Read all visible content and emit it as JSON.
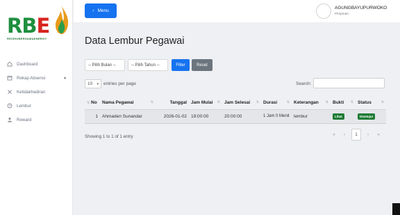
{
  "brand": {
    "logo_text_r": "R",
    "logo_text_b": "B",
    "logo_text_e": "E",
    "tagline": "REZEKIBERSAMAENERGY"
  },
  "sidebar": {
    "items": [
      {
        "label": "Dashboard",
        "icon": "home-icon"
      },
      {
        "label": "Rekap Absensi",
        "icon": "calendar-icon"
      },
      {
        "label": "Ketidakhadiran",
        "icon": "x-icon"
      },
      {
        "label": "Lembur",
        "icon": "clock-icon"
      },
      {
        "label": "Reward",
        "icon": "user-award-icon"
      }
    ]
  },
  "topbar": {
    "menu_label": "Menu",
    "user_name": "AGUNGBAYUPURWOKO",
    "user_role": "Pimpinan"
  },
  "page": {
    "title": "Data Lembur Pegawai"
  },
  "filters": {
    "month_select": "-- Pilih Bulan --",
    "year_select": "-- Pilih Tahun --",
    "filter_label": "Filter",
    "reset_label": "Reset"
  },
  "table_controls": {
    "length_value": "10",
    "length_suffix": "entries per page",
    "search_label": "Search:"
  },
  "table": {
    "headers": [
      "No",
      "Nama Pegawai",
      "Tanggal",
      "Jam Mulai",
      "Jam Selesai",
      "Durasi",
      "Keterangan",
      "Bukti",
      "Status"
    ],
    "rows": [
      {
        "no": "1",
        "nama": "Ahmaden Sunandar",
        "tanggal": "2026-01-02",
        "jam_mulai": "19:00:00",
        "jam_selesai": "20:00:00",
        "durasi": "1 Jam 0 Menit",
        "keterangan": "lembur",
        "bukti": "Lihat",
        "status": "Disetujui"
      }
    ]
  },
  "pagination": {
    "info": "Showing 1 to 1 of 1 entry",
    "first": "«",
    "prev": "‹",
    "current": "1",
    "next": "›",
    "last": "»"
  },
  "colors": {
    "primary": "#1673f0",
    "reset": "#6c757d",
    "success": "#1e7b34",
    "brand_green": "#1e8f3e",
    "brand_red": "#d7261e"
  }
}
